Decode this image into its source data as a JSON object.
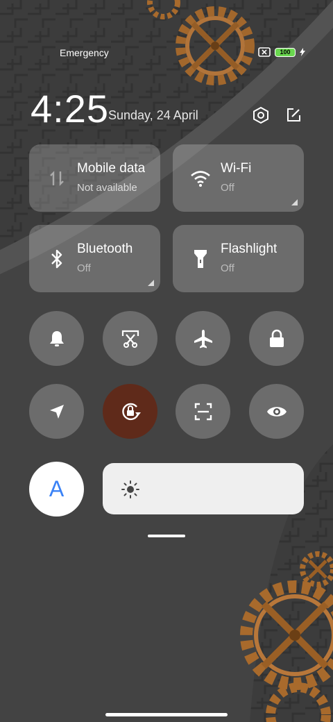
{
  "status_bar": {
    "carrier": "Emergency",
    "battery": "100"
  },
  "clock": {
    "time": "4:25",
    "date": "Sunday, 24 April"
  },
  "tiles": [
    {
      "title": "Mobile data",
      "subtitle": "Not available",
      "icon": "mobile-data-icon"
    },
    {
      "title": "Wi-Fi",
      "subtitle": "Off",
      "icon": "wifi-icon"
    },
    {
      "title": "Bluetooth",
      "subtitle": "Off",
      "icon": "bluetooth-icon"
    },
    {
      "title": "Flashlight",
      "subtitle": "Off",
      "icon": "flashlight-icon"
    }
  ],
  "toggles_row1": [
    "bell-icon",
    "screen-cast-icon",
    "airplane-icon",
    "lock-icon"
  ],
  "toggles_row2": [
    "location-icon",
    "rotation-lock-icon",
    "scanner-icon",
    "eye-icon"
  ],
  "brightness": {
    "auto_label": "A",
    "level": 0.0
  },
  "colors": {
    "active_toggle": "#5f2a1a",
    "auto_accent": "#3a82f6"
  }
}
